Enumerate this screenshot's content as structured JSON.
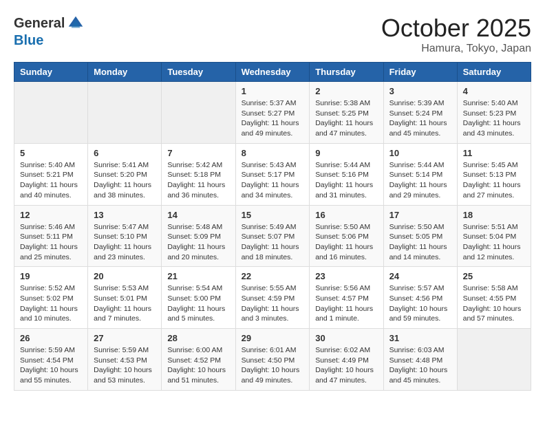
{
  "header": {
    "logo_general": "General",
    "logo_blue": "Blue",
    "month_title": "October 2025",
    "location": "Hamura, Tokyo, Japan"
  },
  "weekdays": [
    "Sunday",
    "Monday",
    "Tuesday",
    "Wednesday",
    "Thursday",
    "Friday",
    "Saturday"
  ],
  "weeks": [
    [
      {
        "day": "",
        "info": ""
      },
      {
        "day": "",
        "info": ""
      },
      {
        "day": "",
        "info": ""
      },
      {
        "day": "1",
        "info": "Sunrise: 5:37 AM\nSunset: 5:27 PM\nDaylight: 11 hours\nand 49 minutes."
      },
      {
        "day": "2",
        "info": "Sunrise: 5:38 AM\nSunset: 5:25 PM\nDaylight: 11 hours\nand 47 minutes."
      },
      {
        "day": "3",
        "info": "Sunrise: 5:39 AM\nSunset: 5:24 PM\nDaylight: 11 hours\nand 45 minutes."
      },
      {
        "day": "4",
        "info": "Sunrise: 5:40 AM\nSunset: 5:23 PM\nDaylight: 11 hours\nand 43 minutes."
      }
    ],
    [
      {
        "day": "5",
        "info": "Sunrise: 5:40 AM\nSunset: 5:21 PM\nDaylight: 11 hours\nand 40 minutes."
      },
      {
        "day": "6",
        "info": "Sunrise: 5:41 AM\nSunset: 5:20 PM\nDaylight: 11 hours\nand 38 minutes."
      },
      {
        "day": "7",
        "info": "Sunrise: 5:42 AM\nSunset: 5:18 PM\nDaylight: 11 hours\nand 36 minutes."
      },
      {
        "day": "8",
        "info": "Sunrise: 5:43 AM\nSunset: 5:17 PM\nDaylight: 11 hours\nand 34 minutes."
      },
      {
        "day": "9",
        "info": "Sunrise: 5:44 AM\nSunset: 5:16 PM\nDaylight: 11 hours\nand 31 minutes."
      },
      {
        "day": "10",
        "info": "Sunrise: 5:44 AM\nSunset: 5:14 PM\nDaylight: 11 hours\nand 29 minutes."
      },
      {
        "day": "11",
        "info": "Sunrise: 5:45 AM\nSunset: 5:13 PM\nDaylight: 11 hours\nand 27 minutes."
      }
    ],
    [
      {
        "day": "12",
        "info": "Sunrise: 5:46 AM\nSunset: 5:11 PM\nDaylight: 11 hours\nand 25 minutes."
      },
      {
        "day": "13",
        "info": "Sunrise: 5:47 AM\nSunset: 5:10 PM\nDaylight: 11 hours\nand 23 minutes."
      },
      {
        "day": "14",
        "info": "Sunrise: 5:48 AM\nSunset: 5:09 PM\nDaylight: 11 hours\nand 20 minutes."
      },
      {
        "day": "15",
        "info": "Sunrise: 5:49 AM\nSunset: 5:07 PM\nDaylight: 11 hours\nand 18 minutes."
      },
      {
        "day": "16",
        "info": "Sunrise: 5:50 AM\nSunset: 5:06 PM\nDaylight: 11 hours\nand 16 minutes."
      },
      {
        "day": "17",
        "info": "Sunrise: 5:50 AM\nSunset: 5:05 PM\nDaylight: 11 hours\nand 14 minutes."
      },
      {
        "day": "18",
        "info": "Sunrise: 5:51 AM\nSunset: 5:04 PM\nDaylight: 11 hours\nand 12 minutes."
      }
    ],
    [
      {
        "day": "19",
        "info": "Sunrise: 5:52 AM\nSunset: 5:02 PM\nDaylight: 11 hours\nand 10 minutes."
      },
      {
        "day": "20",
        "info": "Sunrise: 5:53 AM\nSunset: 5:01 PM\nDaylight: 11 hours\nand 7 minutes."
      },
      {
        "day": "21",
        "info": "Sunrise: 5:54 AM\nSunset: 5:00 PM\nDaylight: 11 hours\nand 5 minutes."
      },
      {
        "day": "22",
        "info": "Sunrise: 5:55 AM\nSunset: 4:59 PM\nDaylight: 11 hours\nand 3 minutes."
      },
      {
        "day": "23",
        "info": "Sunrise: 5:56 AM\nSunset: 4:57 PM\nDaylight: 11 hours\nand 1 minute."
      },
      {
        "day": "24",
        "info": "Sunrise: 5:57 AM\nSunset: 4:56 PM\nDaylight: 10 hours\nand 59 minutes."
      },
      {
        "day": "25",
        "info": "Sunrise: 5:58 AM\nSunset: 4:55 PM\nDaylight: 10 hours\nand 57 minutes."
      }
    ],
    [
      {
        "day": "26",
        "info": "Sunrise: 5:59 AM\nSunset: 4:54 PM\nDaylight: 10 hours\nand 55 minutes."
      },
      {
        "day": "27",
        "info": "Sunrise: 5:59 AM\nSunset: 4:53 PM\nDaylight: 10 hours\nand 53 minutes."
      },
      {
        "day": "28",
        "info": "Sunrise: 6:00 AM\nSunset: 4:52 PM\nDaylight: 10 hours\nand 51 minutes."
      },
      {
        "day": "29",
        "info": "Sunrise: 6:01 AM\nSunset: 4:50 PM\nDaylight: 10 hours\nand 49 minutes."
      },
      {
        "day": "30",
        "info": "Sunrise: 6:02 AM\nSunset: 4:49 PM\nDaylight: 10 hours\nand 47 minutes."
      },
      {
        "day": "31",
        "info": "Sunrise: 6:03 AM\nSunset: 4:48 PM\nDaylight: 10 hours\nand 45 minutes."
      },
      {
        "day": "",
        "info": ""
      }
    ]
  ]
}
